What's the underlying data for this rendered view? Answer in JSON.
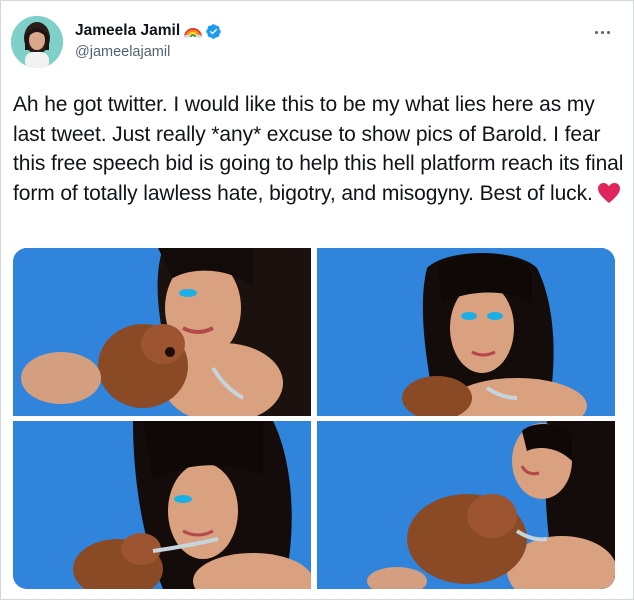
{
  "user": {
    "display_name": "Jameela Jamil",
    "handle": "@jameelajamil",
    "verified": true,
    "badge_icon": "rainbow-icon",
    "avatar_icon": "avatar"
  },
  "tweet": {
    "text": "Ah he got twitter. I would like this to be my what lies here as my last tweet. Just really *any* excuse to show pics of Barold. I fear this free speech bid is going to help this hell platform reach its final form of totally lawless hate, bigotry, and misogyny. Best of luck.",
    "emoji_icon": "red-heart-icon"
  },
  "media": {
    "count": 4,
    "background_color": "#2a7fd6"
  },
  "colors": {
    "text": "#0f1419",
    "secondary": "#536471",
    "verified": "#1d9bf0",
    "heart": "#e0245e",
    "border": "#cfd9de"
  }
}
